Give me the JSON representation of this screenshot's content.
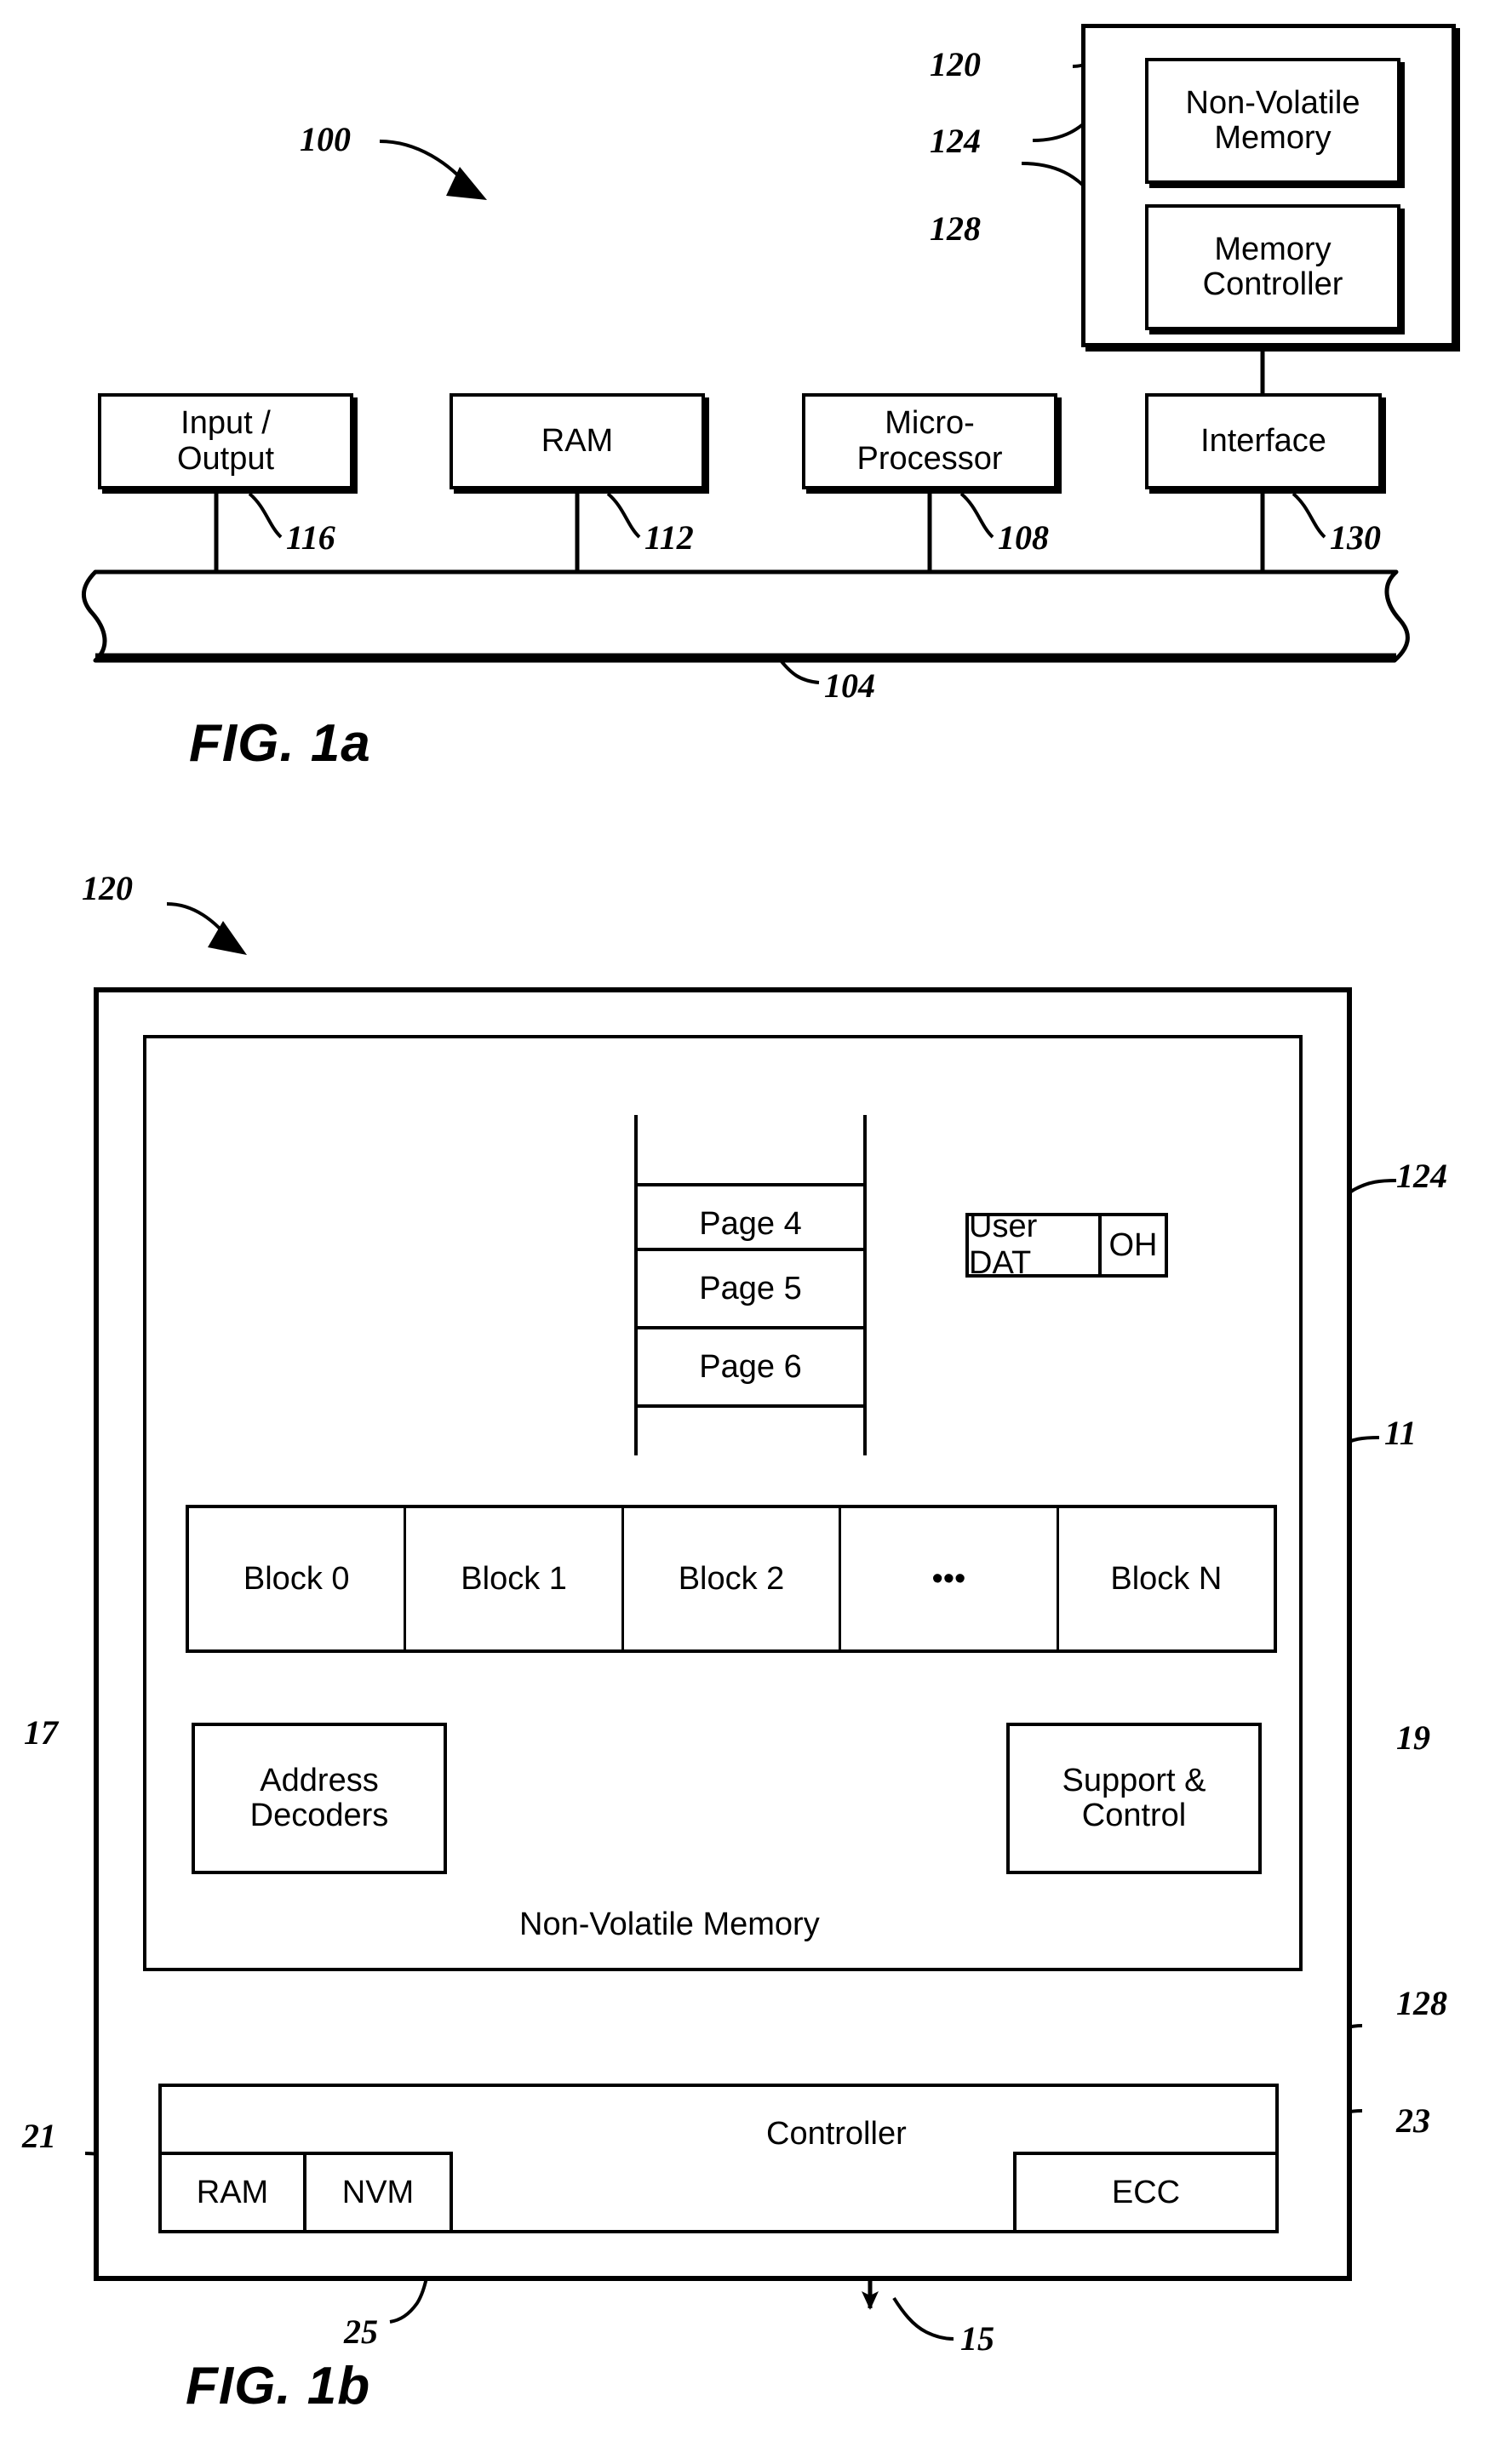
{
  "figures": [
    {
      "caption": "FIG. 1a",
      "system_ref": "100",
      "bus_ref": "104",
      "memory_system": {
        "ref": "120",
        "nvm_ref": "124",
        "nvm_label": "Non-Volatile Memory",
        "controller_ref": "128",
        "controller_label": "Memory Controller"
      },
      "components": [
        {
          "label": "Input / Output",
          "line1": "Input /",
          "line2": "Output",
          "ref": "116"
        },
        {
          "label": "RAM",
          "line1": "RAM",
          "line2": "",
          "ref": "112"
        },
        {
          "label": "Micro-Processor",
          "line1": "Micro-",
          "line2": "Processor",
          "ref": "108"
        },
        {
          "label": "Interface",
          "line1": "Interface",
          "line2": "",
          "ref": "130"
        }
      ]
    },
    {
      "caption": "FIG. 1b",
      "system_ref": "120",
      "nvm_ref": "124",
      "nvm_label": "Non-Volatile Memory",
      "block_array_ref": "11",
      "pages": [
        {
          "label": "",
          "highlighted": false
        },
        {
          "label": "Page 4",
          "highlighted": false
        },
        {
          "label": "Page 5",
          "highlighted": true
        },
        {
          "label": "Page 6",
          "highlighted": false
        },
        {
          "label": "",
          "highlighted": false
        }
      ],
      "page_detail": {
        "data_label": "User DAT",
        "overhead_label": "OH"
      },
      "blocks": [
        {
          "label": "Block 0",
          "highlighted": false
        },
        {
          "label": "Block 1",
          "highlighted": true
        },
        {
          "label": "Block 2",
          "highlighted": false
        },
        {
          "label": "•••",
          "highlighted": false
        },
        {
          "label": "Block N",
          "highlighted": false
        }
      ],
      "address_decoders": {
        "line1": "Address",
        "line2": "Decoders",
        "ref": "17"
      },
      "support_control": {
        "line1": "Support &",
        "line2": "Control",
        "ref": "19"
      },
      "controller": {
        "label": "Controller",
        "ref": "128",
        "ram": {
          "label": "RAM",
          "ref": "21"
        },
        "nvm": {
          "label": "NVM",
          "ref": "25"
        },
        "ecc": {
          "label": "ECC",
          "ref": "23"
        }
      },
      "host_bus_ref": "15"
    }
  ]
}
